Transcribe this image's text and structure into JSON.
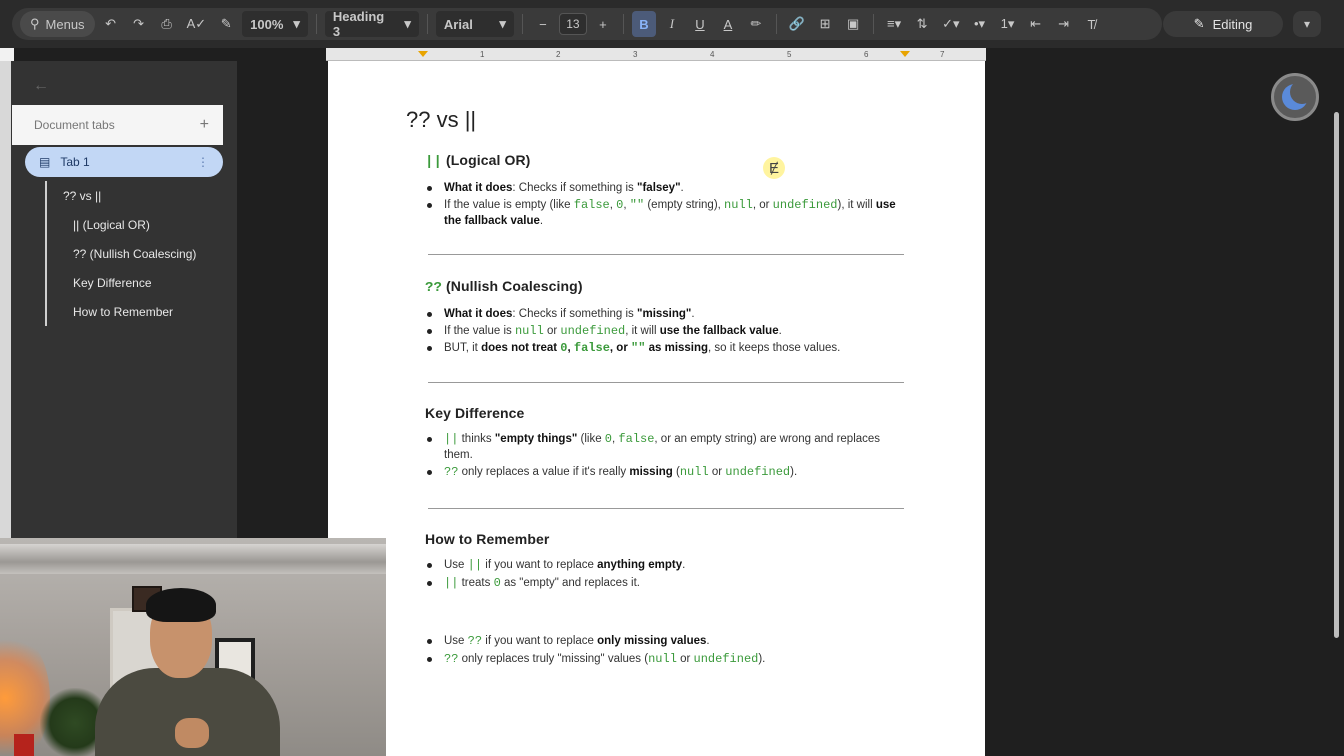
{
  "toolbar": {
    "menus_label": "Menus",
    "zoom": "100%",
    "style": "Heading 3",
    "font": "Arial",
    "font_size": "13",
    "mode_label": "Editing"
  },
  "sidebar": {
    "doc_tabs_label": "Document tabs",
    "add_tab": "+",
    "tab_label": "Tab 1",
    "outline": [
      {
        "label": "?? vs ||"
      },
      {
        "label": "|| (Logical OR)"
      },
      {
        "label": "?? (Nullish Coalescing)"
      },
      {
        "label": "Key Difference"
      },
      {
        "label": "How to Remember"
      }
    ]
  },
  "ruler": {
    "ticks": [
      "1",
      "1",
      "2",
      "3",
      "4",
      "5",
      "6",
      "7"
    ]
  },
  "doc": {
    "title": "?? vs ||",
    "s1": {
      "code": "||",
      "heading": " (Logical OR)",
      "b1_label": "What it does",
      "b1_text": ": Checks if something is ",
      "b1_emph": "\"falsey\"",
      "b2_a": "If the value is empty (like ",
      "b2_c1": "false",
      "b2_c2": "0",
      "b2_c3": "\"\"",
      "b2_b": " (empty string), ",
      "b2_c4": "null",
      "b2_or": ", or ",
      "b2_c5": "undefined",
      "b2_c": "), it will ",
      "b2_emph": "use the fallback value"
    },
    "s2": {
      "code": "??",
      "heading": " (Nullish Coalescing)",
      "b1_label": "What it does",
      "b1_text": ": Checks if something is ",
      "b1_emph": "\"missing\"",
      "b2_a": "If the value is ",
      "b2_c1": "null",
      "b2_or": " or ",
      "b2_c2": "undefined",
      "b2_b": ", it will ",
      "b2_emph": "use the fallback value",
      "b3_a": "BUT, it ",
      "b3_emph1": "does not treat ",
      "b3_c1": "0",
      "b3_c2": "false",
      "b3_or": ", or ",
      "b3_c3": "\"\"",
      "b3_emph2": " as missing",
      "b3_b": ", so it keeps those values."
    },
    "s3": {
      "heading": "Key Difference",
      "b1_code": "||",
      "b1_a": " thinks ",
      "b1_emph": "\"empty things\"",
      "b1_b": " (like ",
      "b1_c1": "0",
      "b1_c2": "false",
      "b1_c": ", or an empty string) are wrong and replaces them.",
      "b2_code": "??",
      "b2_a": " only replaces a value if it's really ",
      "b2_emph": "missing",
      "b2_c1": "null",
      "b2_or": " or ",
      "b2_c2": "undefined"
    },
    "s4": {
      "heading": "How to Remember",
      "b1_a": "Use ",
      "b1_code": "||",
      "b1_b": " if you want to replace ",
      "b1_emph": "anything empty",
      "b2_code": "||",
      "b2_a": " treats ",
      "b2_c1": "0",
      "b2_b": " as \"empty\" and replaces it.",
      "b3_a": "Use ",
      "b3_code": "??",
      "b3_b": " if you want to replace ",
      "b3_emph": "only missing values",
      "b4_code": "??",
      "b4_a": " only replaces truly \"missing\" values (",
      "b4_c1": "null",
      "b4_or": " or ",
      "b4_c2": "undefined"
    }
  }
}
